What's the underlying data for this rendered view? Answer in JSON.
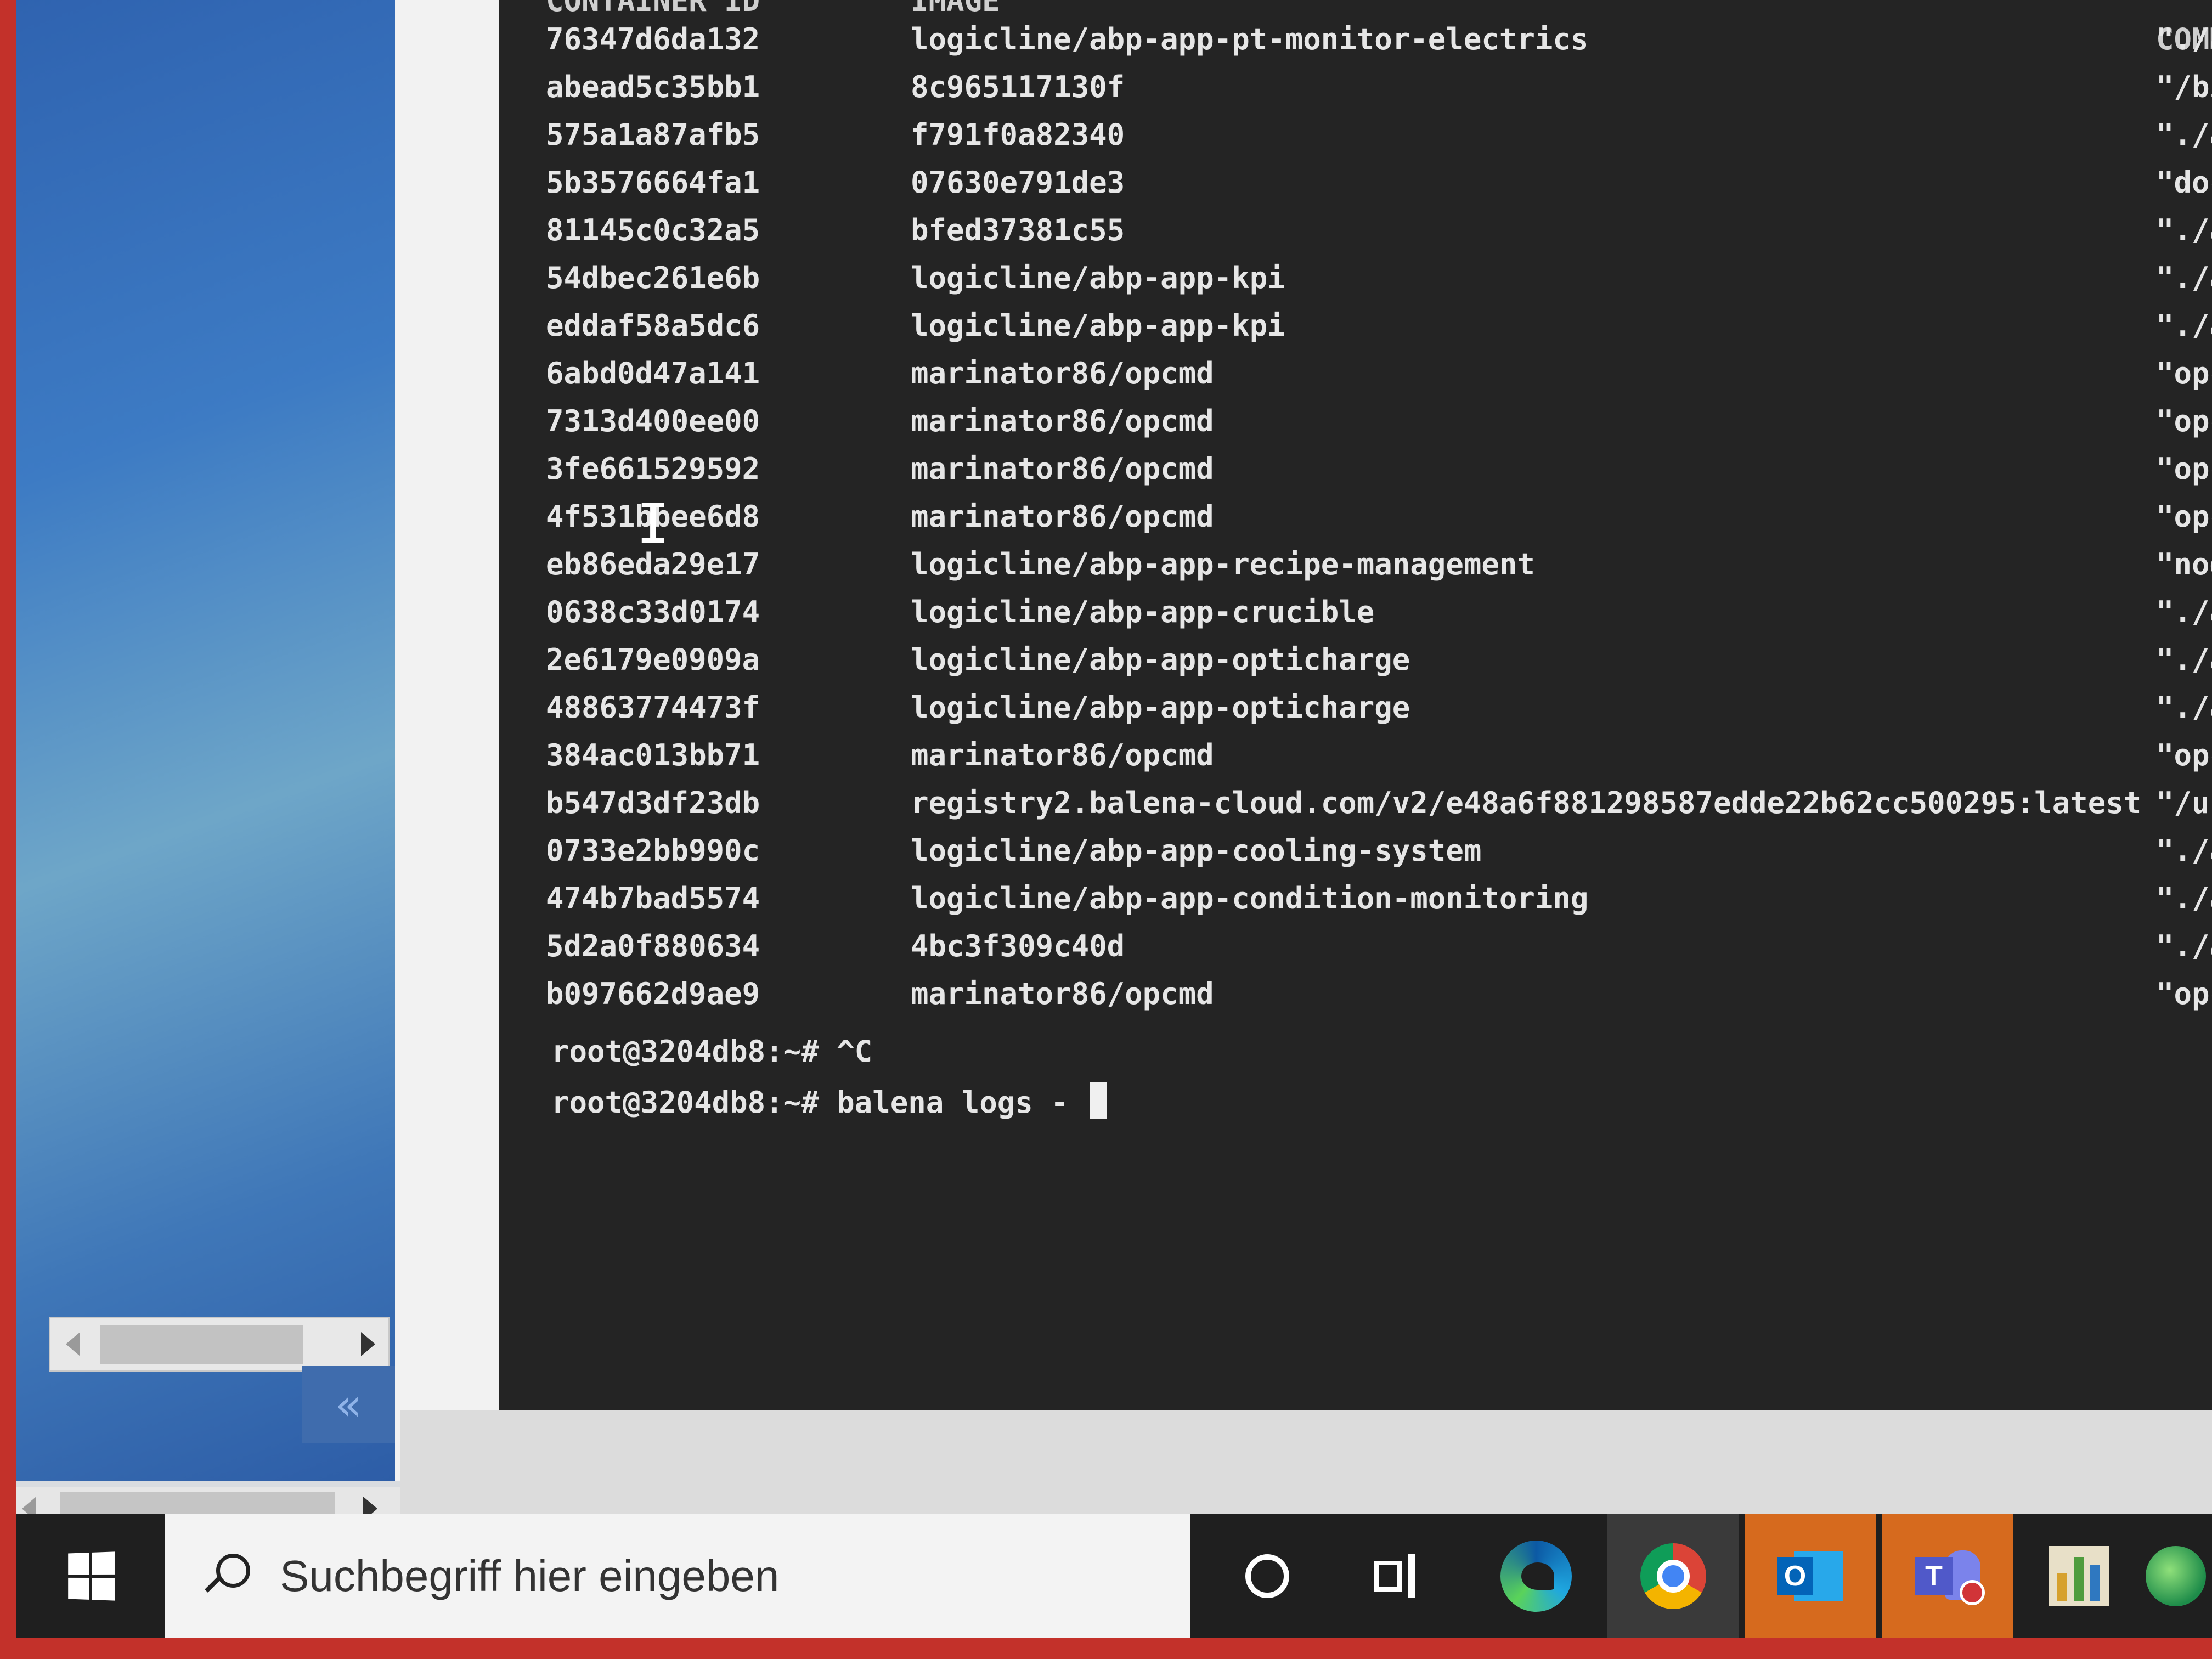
{
  "terminal": {
    "header": {
      "container_id": "CONTAINER ID",
      "image": "IMAGE",
      "command": "COMM"
    },
    "rows": [
      {
        "id": "76347d6da132",
        "image": "logicline/abp-app-pt-monitor-electrics",
        "cmd": "\"./a"
      },
      {
        "id": "abead5c35bb1",
        "image": "8c965117130f",
        "cmd": "\"/bi"
      },
      {
        "id": "575a1a87afb5",
        "image": "f791f0a82340",
        "cmd": "\"./a"
      },
      {
        "id": "5b3576664fa1",
        "image": "07630e791de3",
        "cmd": "\"doc"
      },
      {
        "id": "81145c0c32a5",
        "image": "bfed37381c55",
        "cmd": "\"./a"
      },
      {
        "id": "54dbec261e6b",
        "image": "logicline/abp-app-kpi",
        "cmd": "\"./a"
      },
      {
        "id": "eddaf58a5dc6",
        "image": "logicline/abp-app-kpi",
        "cmd": "\"./a"
      },
      {
        "id": "6abd0d47a141",
        "image": "marinator86/opcmd",
        "cmd": "\"opc"
      },
      {
        "id": "7313d400ee00",
        "image": "marinator86/opcmd",
        "cmd": "\"opc"
      },
      {
        "id": "3fe661529592",
        "image": "marinator86/opcmd",
        "cmd": "\"opc"
      },
      {
        "id": "4f531bbee6d8",
        "image": "marinator86/opcmd",
        "cmd": "\"opc"
      },
      {
        "id": "eb86eda29e17",
        "image": "logicline/abp-app-recipe-management",
        "cmd": "\"node"
      },
      {
        "id": "0638c33d0174",
        "image": "logicline/abp-app-crucible",
        "cmd": "\"./ap"
      },
      {
        "id": "2e6179e0909a",
        "image": "logicline/abp-app-opticharge",
        "cmd": "\"./ap"
      },
      {
        "id": "48863774473f",
        "image": "logicline/abp-app-opticharge",
        "cmd": "\"./ap"
      },
      {
        "id": "384ac013bb71",
        "image": "marinator86/opcmd",
        "cmd": "\"opcu"
      },
      {
        "id": "b547d3df23db",
        "image": "registry2.balena-cloud.com/v2/e48a6f881298587edde22b62cc500295:latest",
        "cmd": "\"/usr"
      },
      {
        "id": "0733e2bb990c",
        "image": "logicline/abp-app-cooling-system",
        "cmd": "\"./ap"
      },
      {
        "id": "474b7bad5574",
        "image": "logicline/abp-app-condition-monitoring",
        "cmd": "\"./ap"
      },
      {
        "id": "5d2a0f880634",
        "image": "4bc3f309c40d",
        "cmd": "\"./ap"
      },
      {
        "id": "b097662d9ae9",
        "image": "marinator86/opcmd",
        "cmd": "\"opcu"
      }
    ],
    "prompt_1": "root@3204db8:~# ^C",
    "prompt_2": "root@3204db8:~# balena logs - "
  },
  "side_panel": {
    "collapse_label": "«"
  },
  "taskbar": {
    "search_placeholder": "Suchbegriff hier eingeben",
    "icons": [
      "windows-start-icon",
      "search-icon",
      "cortana-icon",
      "task-view-icon",
      "edge-icon",
      "chrome-icon",
      "outlook-icon",
      "teams-icon",
      "chart-app-icon",
      "globe-app-icon"
    ]
  },
  "colors": {
    "terminal_bg": "#242424",
    "terminal_fg": "#e6e6e6",
    "taskbar_bg": "#1f1f1f",
    "accent_orange": "#d66a1e",
    "bezel_red": "#c3312a"
  }
}
